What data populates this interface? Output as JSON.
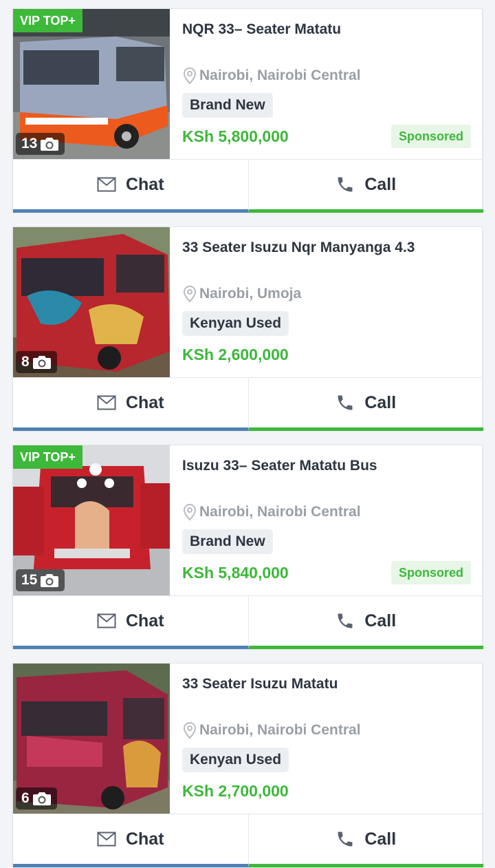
{
  "listings": [
    {
      "badge": "VIP TOP+",
      "photo_count": "13",
      "title": "NQR 33– Seater Matatu",
      "location": "Nairobi, Nairobi Central",
      "condition": "Brand New",
      "price": "KSh 5,800,000",
      "sponsored": "Sponsored",
      "chat_label": "Chat",
      "call_label": "Call"
    },
    {
      "photo_count": "8",
      "title": "33 Seater Isuzu Nqr Manyanga 4.3",
      "location": "Nairobi, Umoja",
      "condition": "Kenyan Used",
      "price": "KSh 2,600,000",
      "chat_label": "Chat",
      "call_label": "Call"
    },
    {
      "badge": "VIP TOP+",
      "photo_count": "15",
      "title": "Isuzu 33– Seater Matatu Bus",
      "location": "Nairobi, Nairobi Central",
      "condition": "Brand New",
      "price": "KSh 5,840,000",
      "sponsored": "Sponsored",
      "chat_label": "Chat",
      "call_label": "Call"
    },
    {
      "photo_count": "6",
      "title": "33 Seater Isuzu Matatu",
      "location": "Nairobi, Nairobi Central",
      "condition": "Kenyan Used",
      "price": "KSh 2,700,000",
      "chat_label": "Chat",
      "call_label": "Call"
    }
  ],
  "icons": {
    "camera": "camera-icon",
    "location": "location-pin-icon",
    "chat": "envelope-icon",
    "call": "phone-icon"
  },
  "colors": {
    "price_green": "#3db83a",
    "badge_green": "#3db83a",
    "chat_blue": "#4f81b4",
    "sponsored_bg": "#e7f6e6"
  }
}
